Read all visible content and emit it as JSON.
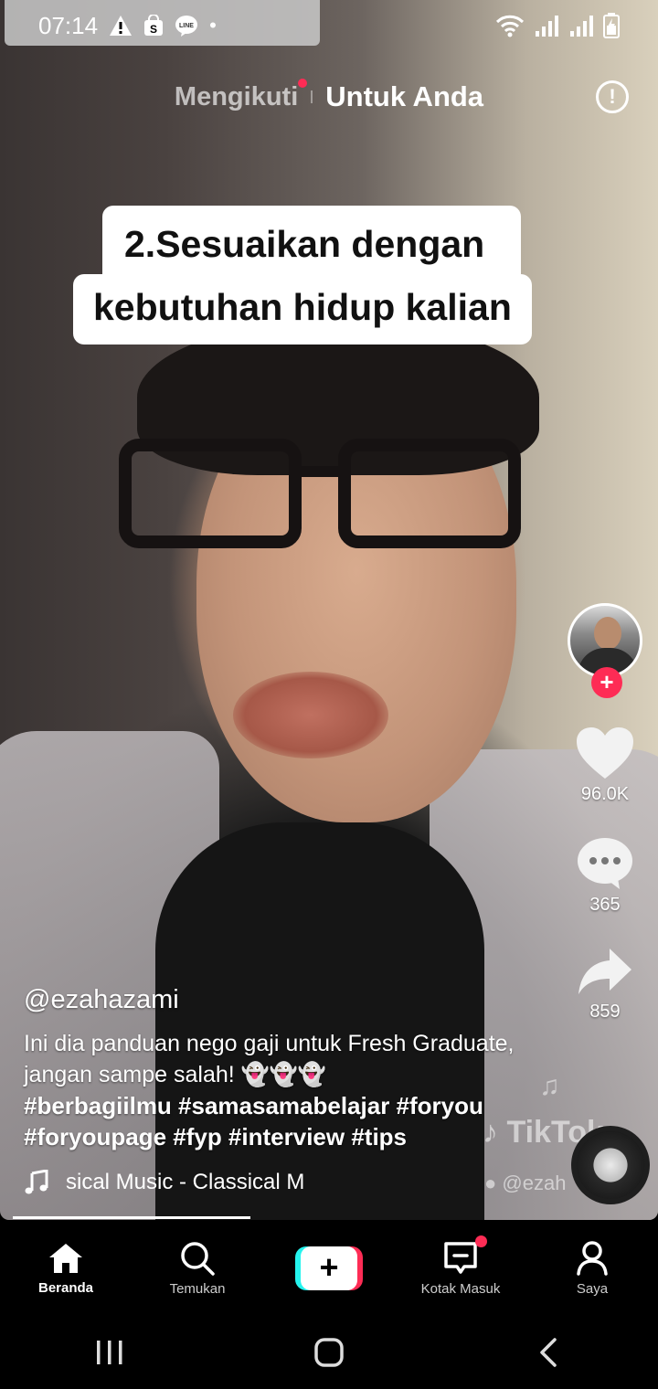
{
  "status_bar": {
    "time": "07:14",
    "dot": "•"
  },
  "top_tabs": {
    "following": "Mengikuti",
    "for_you": "Untuk Anda"
  },
  "report_button": "!",
  "overlay_caption": {
    "line1": "2.Sesuaikan dengan",
    "line2": "kebutuhan hidup kalian"
  },
  "rail": {
    "follow_plus": "+",
    "likes": "96.0K",
    "comments": "365",
    "shares": "859"
  },
  "post": {
    "username": "@ezahazami",
    "description": "Ini dia panduan nego gaji untuk Fresh Graduate, jangan sampe salah! 👻👻👻",
    "hashtags": "#berbagiilmu #samasamabelajar #foryou #foryoupage #fyp #interview #tips",
    "music": "sical Music - Classical M"
  },
  "watermark": {
    "brand": "TikTok",
    "handle": "@ezah"
  },
  "bottom_nav": {
    "home": "Beranda",
    "discover": "Temukan",
    "create": "+",
    "inbox": "Kotak Masuk",
    "profile": "Saya"
  },
  "colors": {
    "accent_red": "#fe2c55",
    "accent_cyan": "#25f4ee"
  },
  "icons": {
    "status": [
      "warning-icon",
      "shop-icon",
      "line-icon",
      "wifi-icon",
      "signal-icon",
      "battery-icon"
    ],
    "rail": [
      "heart-icon",
      "comment-icon",
      "share-icon"
    ],
    "nav": [
      "home-icon",
      "search-icon",
      "plus-icon",
      "inbox-icon",
      "profile-icon"
    ]
  }
}
